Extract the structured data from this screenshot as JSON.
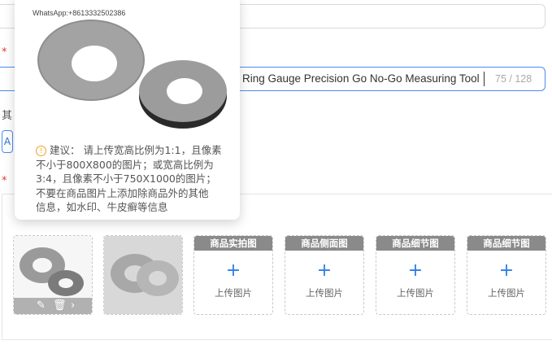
{
  "form": {
    "required_mark": "*",
    "title_value": "Ring Gauge Precision Go No-Go Measuring Tool",
    "title_counter": "75 / 128",
    "other_label": "其",
    "small_button_text": "A"
  },
  "tooltip": {
    "watermark": "WhatsApp:+8613332502386",
    "advice_lines": [
      "建议： 请上传宽高比例为1:1，且像素",
      "不小于800X800的图片；或宽高比例为",
      "3:4，且像素不小于750X1000的图片；",
      "不要在商品图片上添加除商品外的其他",
      "信息，如水印、牛皮癣等信息"
    ]
  },
  "images": {
    "upload_slots": [
      {
        "header": "商品实拍图",
        "caption": "上传图片"
      },
      {
        "header": "商品侧面图",
        "caption": "上传图片"
      },
      {
        "header": "商品细节图",
        "caption": "上传图片"
      },
      {
        "header": "商品细节图",
        "caption": "上传图片"
      }
    ],
    "icons": {
      "edit": "edit-icon",
      "delete": "trash-icon",
      "next": "chevron-right-icon",
      "info": "info-icon",
      "plus": "plus-icon"
    }
  },
  "colors": {
    "accent": "#2f7ee8",
    "required": "#e53935",
    "slot_header": "#8a8a8a",
    "warning": "#f0a020"
  }
}
